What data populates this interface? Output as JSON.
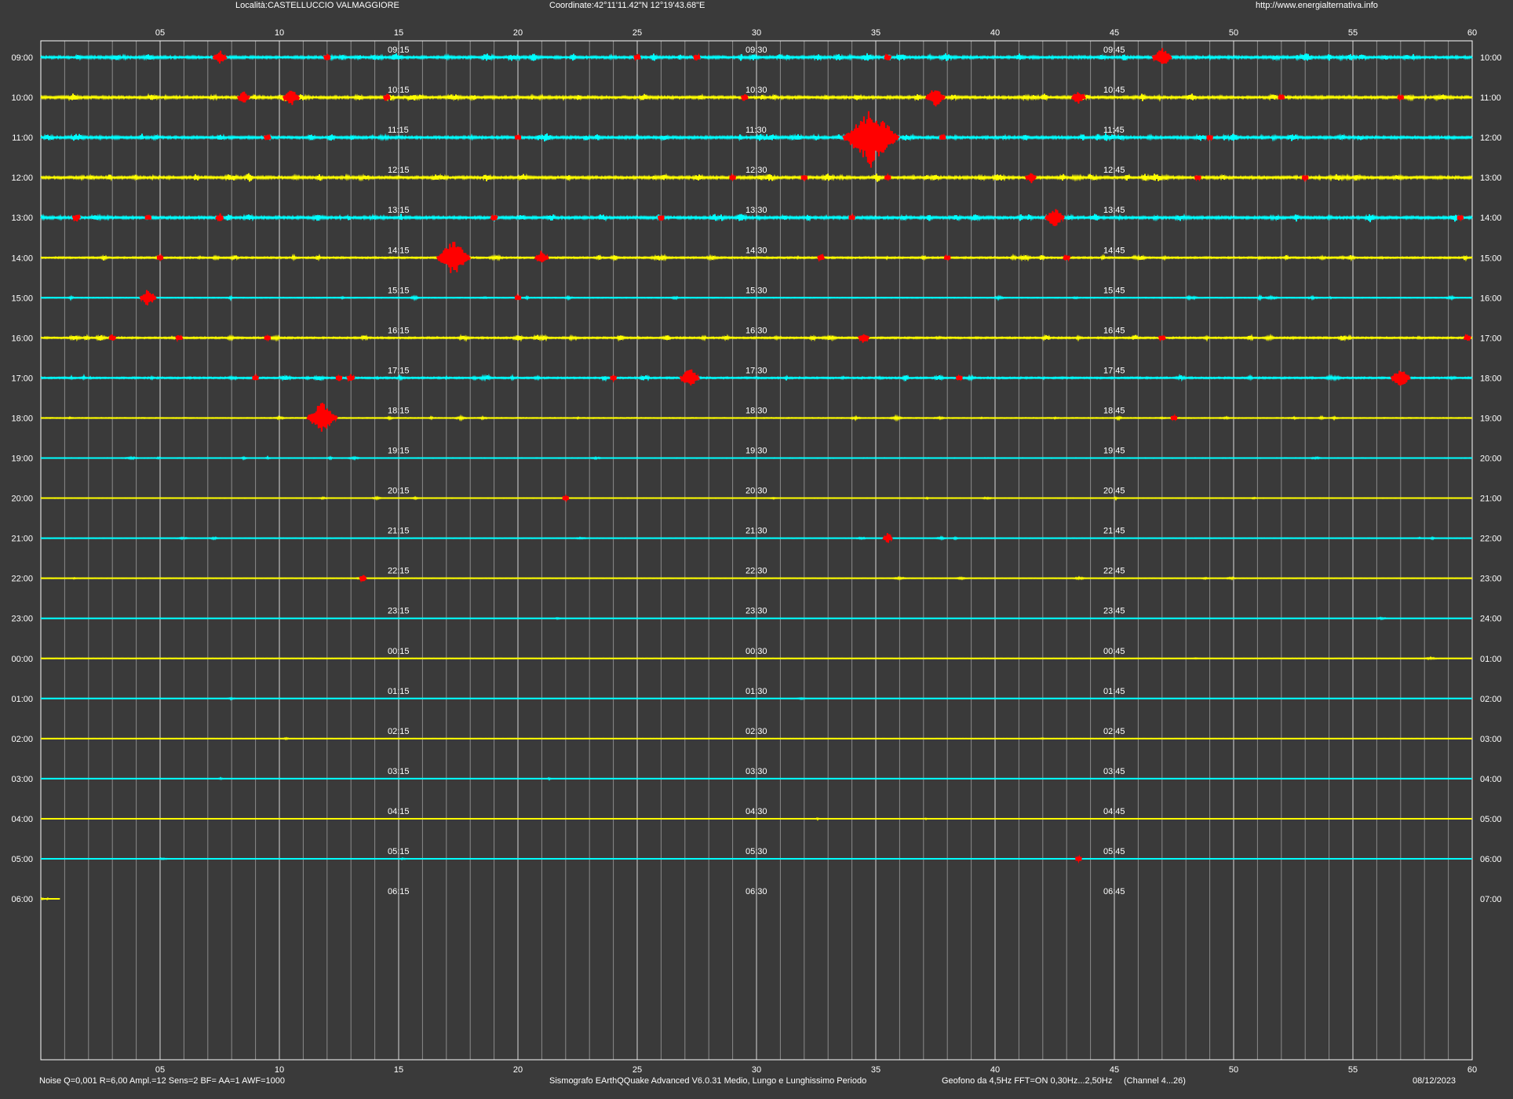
{
  "header": {
    "location": "Località:CASTELLUCCIO VALMAGGIORE",
    "coordinates": "Coordinate:42°11'11.42\"N  12°19'43.68\"E",
    "website": "http://www.energialternativa.info"
  },
  "footer": {
    "noise_settings": "Noise Q=0,001 R=6,00 Ampl.=12 Sens=2 BF= AA=1 AWF=1000",
    "software": "Sismografo  EArthQQuake Advanced V6.0.31  Medio, Lungo e Lunghissimo Periodo",
    "geophone": "Geofono da 4,5Hz FFT=ON 0,30Hz...2,50Hz",
    "channel": "(Channel 4...26)",
    "date": "08/12/2023"
  },
  "colors": {
    "background": "#3a3a3a",
    "plot_border": "#ffffff",
    "major_grid": "#d8d8d8",
    "minor_grid": "#8a8a8a",
    "trace_a": "#00ffff",
    "trace_b": "#ffff00",
    "event": "#ff0000",
    "text": "#ffffff"
  },
  "chart_data": {
    "type": "line",
    "x_minutes_per_row": 60,
    "x_ticks": [
      "05",
      "10",
      "15",
      "20",
      "25",
      "30",
      "35",
      "40",
      "45",
      "50",
      "55",
      "60"
    ],
    "x_minor_tick_step_minutes": 1,
    "grid": true,
    "row_colors": [
      "trace_a",
      "trace_b"
    ],
    "rows": [
      {
        "left": "09:00",
        "right": "10:00",
        "marks": [
          "09:15",
          "09:30",
          "09:45"
        ],
        "activity": "high",
        "events": [
          {
            "minute": 7.5,
            "amp": 10
          },
          {
            "minute": 12,
            "amp": 5
          },
          {
            "minute": 25,
            "amp": 5
          },
          {
            "minute": 27.5,
            "amp": 5
          },
          {
            "minute": 35.5,
            "amp": 5
          },
          {
            "minute": 47,
            "amp": 14
          }
        ]
      },
      {
        "left": "10:00",
        "right": "11:00",
        "marks": [
          "10:15",
          "10:30",
          "10:45"
        ],
        "activity": "high",
        "events": [
          {
            "minute": 8.5,
            "amp": 9
          },
          {
            "minute": 10.5,
            "amp": 12
          },
          {
            "minute": 14.5,
            "amp": 5
          },
          {
            "minute": 29.5,
            "amp": 5
          },
          {
            "minute": 37.5,
            "amp": 14
          },
          {
            "minute": 43.5,
            "amp": 10
          },
          {
            "minute": 52,
            "amp": 4
          },
          {
            "minute": 57,
            "amp": 4
          }
        ]
      },
      {
        "left": "11:00",
        "right": "12:00",
        "marks": [
          "11:15",
          "11:30",
          "11:45"
        ],
        "activity": "high",
        "events": [
          {
            "minute": 9.5,
            "amp": 5
          },
          {
            "minute": 20,
            "amp": 4
          },
          {
            "minute": 34.8,
            "amp": 40
          },
          {
            "minute": 37.8,
            "amp": 4
          },
          {
            "minute": 49,
            "amp": 4
          }
        ]
      },
      {
        "left": "12:00",
        "right": "13:00",
        "marks": [
          "12:15",
          "12:30",
          "12:45"
        ],
        "activity": "high",
        "events": [
          {
            "minute": 29,
            "amp": 3
          },
          {
            "minute": 32,
            "amp": 3
          },
          {
            "minute": 35.5,
            "amp": 3
          },
          {
            "minute": 41.5,
            "amp": 8
          },
          {
            "minute": 48.5,
            "amp": 4
          },
          {
            "minute": 53,
            "amp": 3
          }
        ]
      },
      {
        "left": "13:00",
        "right": "14:00",
        "marks": [
          "13:15",
          "13:30",
          "13:45"
        ],
        "activity": "high",
        "events": [
          {
            "minute": 1.5,
            "amp": 6
          },
          {
            "minute": 4.5,
            "amp": 4
          },
          {
            "minute": 7.5,
            "amp": 6
          },
          {
            "minute": 19,
            "amp": 5
          },
          {
            "minute": 26,
            "amp": 4
          },
          {
            "minute": 34,
            "amp": 3
          },
          {
            "minute": 42.5,
            "amp": 14
          },
          {
            "minute": 59.5,
            "amp": 3
          }
        ]
      },
      {
        "left": "14:00",
        "right": "15:00",
        "marks": [
          "14:15",
          "14:30",
          "14:45"
        ],
        "activity": "medium",
        "events": [
          {
            "minute": 5,
            "amp": 3
          },
          {
            "minute": 17.3,
            "amp": 24
          },
          {
            "minute": 21,
            "amp": 10
          },
          {
            "minute": 32.7,
            "amp": 5
          },
          {
            "minute": 38,
            "amp": 4
          },
          {
            "minute": 43,
            "amp": 5
          }
        ]
      },
      {
        "left": "15:00",
        "right": "16:00",
        "marks": [
          "15:15",
          "15:30",
          "15:45"
        ],
        "activity": "low",
        "events": [
          {
            "minute": 4.5,
            "amp": 12
          },
          {
            "minute": 20,
            "amp": 3
          }
        ]
      },
      {
        "left": "16:00",
        "right": "17:00",
        "marks": [
          "16:15",
          "16:30",
          "16:45"
        ],
        "activity": "medium",
        "events": [
          {
            "minute": 3,
            "amp": 5
          },
          {
            "minute": 5.8,
            "amp": 5
          },
          {
            "minute": 9.5,
            "amp": 3
          },
          {
            "minute": 34.5,
            "amp": 8
          },
          {
            "minute": 47,
            "amp": 5
          },
          {
            "minute": 59.8,
            "amp": 5
          }
        ]
      },
      {
        "left": "17:00",
        "right": "18:00",
        "marks": [
          "17:15",
          "17:30",
          "17:45"
        ],
        "activity": "medium",
        "events": [
          {
            "minute": 9,
            "amp": 3
          },
          {
            "minute": 12.5,
            "amp": 4
          },
          {
            "minute": 13,
            "amp": 6
          },
          {
            "minute": 24,
            "amp": 3
          },
          {
            "minute": 27.2,
            "amp": 14
          },
          {
            "minute": 38.5,
            "amp": 4
          },
          {
            "minute": 57,
            "amp": 14
          }
        ]
      },
      {
        "left": "18:00",
        "right": "19:00",
        "marks": [
          "18:15",
          "18:30",
          "18:45"
        ],
        "activity": "low",
        "events": [
          {
            "minute": 11.8,
            "amp": 22
          },
          {
            "minute": 47.5,
            "amp": 4
          }
        ]
      },
      {
        "left": "19:00",
        "right": "20:00",
        "marks": [
          "19:15",
          "19:30",
          "19:45"
        ],
        "activity": "very_low",
        "events": []
      },
      {
        "left": "20:00",
        "right": "21:00",
        "marks": [
          "20:15",
          "20:30",
          "20:45"
        ],
        "activity": "very_low",
        "events": [
          {
            "minute": 22,
            "amp": 3
          }
        ]
      },
      {
        "left": "21:00",
        "right": "22:00",
        "marks": [
          "21:15",
          "21:30",
          "21:45"
        ],
        "activity": "very_low",
        "events": [
          {
            "minute": 35.5,
            "amp": 7
          }
        ]
      },
      {
        "left": "22:00",
        "right": "23:00",
        "marks": [
          "22:15",
          "22:30",
          "22:45"
        ],
        "activity": "very_low",
        "events": [
          {
            "minute": 13.5,
            "amp": 5
          }
        ]
      },
      {
        "left": "23:00",
        "right": "24:00",
        "marks": [
          "23:15",
          "23:30",
          "23:45"
        ],
        "activity": "quiet",
        "events": []
      },
      {
        "left": "00:00",
        "right": "01:00",
        "marks": [
          "00:15",
          "00:30",
          "00:45"
        ],
        "activity": "quiet",
        "events": []
      },
      {
        "left": "01:00",
        "right": "02:00",
        "marks": [
          "01:15",
          "01:30",
          "01:45"
        ],
        "activity": "quiet",
        "events": []
      },
      {
        "left": "02:00",
        "right": "03:00",
        "marks": [
          "02:15",
          "02:30",
          "02:45"
        ],
        "activity": "quiet",
        "events": []
      },
      {
        "left": "03:00",
        "right": "04:00",
        "marks": [
          "03:15",
          "03:30",
          "03:45"
        ],
        "activity": "quiet",
        "events": []
      },
      {
        "left": "04:00",
        "right": "05:00",
        "marks": [
          "04:15",
          "04:30",
          "04:45"
        ],
        "activity": "quiet",
        "events": []
      },
      {
        "left": "05:00",
        "right": "06:00",
        "marks": [
          "05:15",
          "05:30",
          "05:45"
        ],
        "activity": "quiet",
        "events": [
          {
            "minute": 43.5,
            "amp": 3
          }
        ]
      },
      {
        "left": "06:00",
        "right": "07:00",
        "marks": [
          "06:15",
          "06:30",
          "06:45"
        ],
        "activity": "quiet",
        "events": [],
        "trace_end_minute": 0.8
      }
    ]
  }
}
